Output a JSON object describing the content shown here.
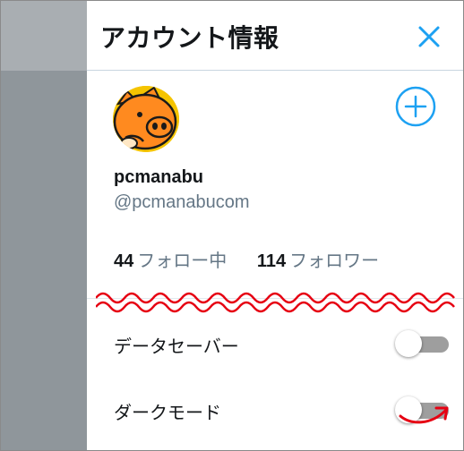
{
  "drawer": {
    "title": "アカウント情報"
  },
  "profile": {
    "display_name": "pcmanabu",
    "handle": "@pcmanabucom"
  },
  "stats": {
    "following_count": "44",
    "following_label": "フォロー中",
    "followers_count": "114",
    "followers_label": "フォロワー"
  },
  "settings": [
    {
      "label": "データセーバー",
      "enabled": false
    },
    {
      "label": "ダークモード",
      "enabled": false
    }
  ],
  "colors": {
    "accent": "#1da1f2",
    "annotation": "#e60012",
    "avatar_orange": "#ff8a1f",
    "avatar_yellow": "#f5c400",
    "backdrop": "#8f969b"
  },
  "icons": {
    "close": "close-icon",
    "add_account": "plus-circle-icon",
    "avatar": "pig-avatar-icon"
  }
}
